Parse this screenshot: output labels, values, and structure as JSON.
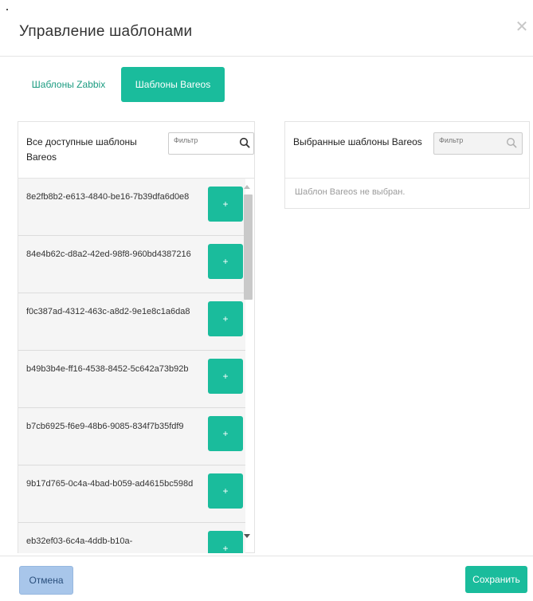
{
  "dialog": {
    "title": "Управление шаблонами"
  },
  "tabs": [
    {
      "label": "Шаблоны Zabbix",
      "active": false
    },
    {
      "label": "Шаблоны Bareos",
      "active": true
    }
  ],
  "available": {
    "title": "Все доступные шаблоны Bareos",
    "filter_placeholder": "Фильтр",
    "add_label": "+",
    "items": [
      {
        "name": "8e2fb8b2-e613-4840-be16-7b39dfa6d0e8"
      },
      {
        "name": "84e4b62c-d8a2-42ed-98f8-960bd4387216"
      },
      {
        "name": "f0c387ad-4312-463c-a8d2-9e1e8c1a6da8"
      },
      {
        "name": "b49b3b4e-ff16-4538-8452-5c642a73b92b"
      },
      {
        "name": "b7cb6925-f6e9-48b6-9085-834f7b35fdf9"
      },
      {
        "name": "9b17d765-0c4a-4bad-b059-ad4615bc598d"
      },
      {
        "name": "eb32ef03-6c4a-4ddb-b10a-"
      }
    ]
  },
  "selected": {
    "title": "Выбранные шаблоны Bareos",
    "filter_placeholder": "Фильтр",
    "empty_text": "Шаблон Bareos не выбран."
  },
  "footer": {
    "cancel_label": "Отмена",
    "save_label": "Сохранить"
  },
  "colors": {
    "accent": "#1abc9c",
    "cancel_bg": "#a8c6ea"
  },
  "icons": {
    "close": "close-icon",
    "search": "search-icon"
  }
}
